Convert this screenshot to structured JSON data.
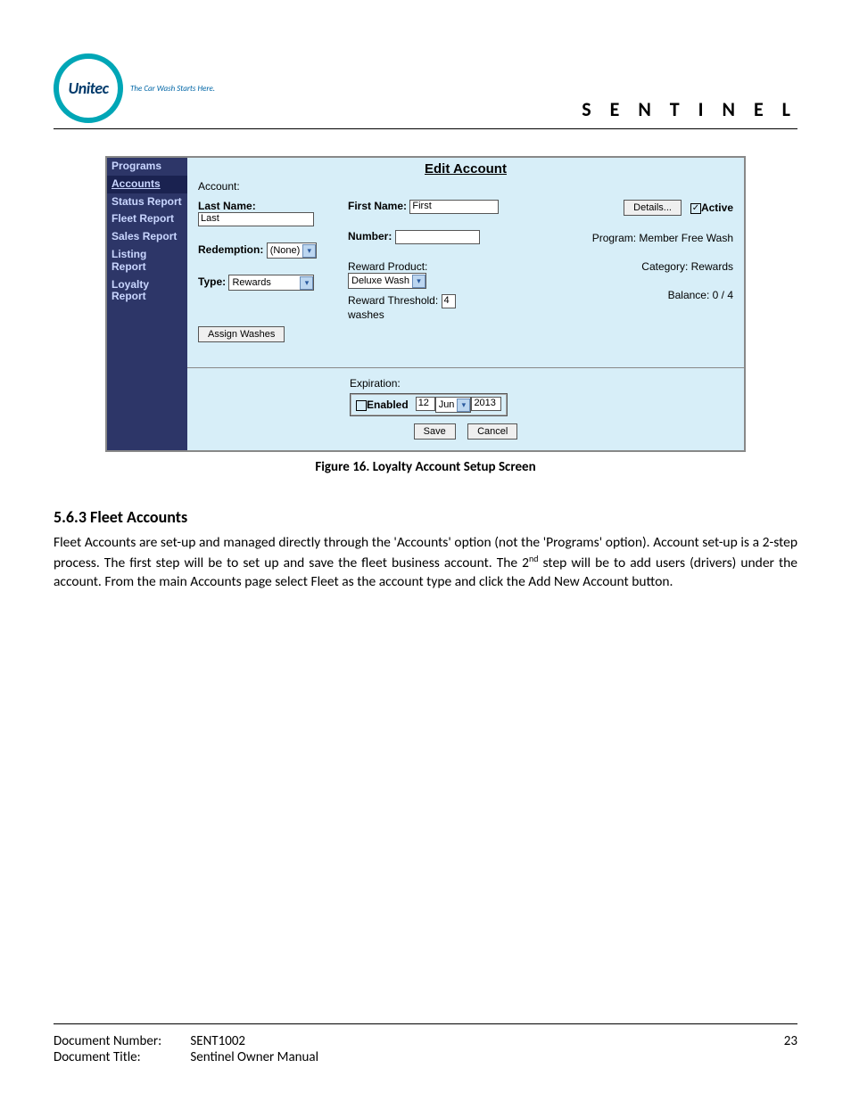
{
  "header": {
    "logo_text": "Unitec",
    "tagline": "The Car Wash Starts Here.",
    "product": "S E N T I N E L"
  },
  "screenshot": {
    "sidebar": {
      "items": [
        {
          "label": "Programs"
        },
        {
          "label": "Accounts",
          "selected": true
        },
        {
          "label": "Status Report"
        },
        {
          "label": "Fleet Report"
        },
        {
          "label": "Sales Report"
        },
        {
          "label": "Listing Report"
        },
        {
          "label": "Loyalty Report"
        }
      ]
    },
    "title": "Edit Account",
    "account_label": "Account:",
    "col1": {
      "last_name_label": "Last Name:",
      "last_name_value": "Last",
      "redemption_label": "Redemption:",
      "redemption_value": "(None)",
      "type_label": "Type:",
      "type_value": "Rewards",
      "assign_button": "Assign Washes"
    },
    "col2": {
      "first_name_label": "First Name:",
      "first_name_value": "First",
      "number_label": "Number:",
      "reward_product_label": "Reward Product:",
      "reward_product_value": "Deluxe Wash",
      "reward_threshold_label": "Reward Threshold:",
      "reward_threshold_value": "4",
      "reward_threshold_suffix": "washes",
      "expiration_label": "Expiration:",
      "enabled_label": "Enabled",
      "exp_day": "12",
      "exp_month": "Jun",
      "exp_year": "2013",
      "save_button": "Save",
      "cancel_button": "Cancel"
    },
    "col3": {
      "details_button": "Details...",
      "active_label": "Active",
      "program_label": "Program: Member Free Wash",
      "category_label": "Category: Rewards",
      "balance_label": "Balance: 0 / 4"
    }
  },
  "figure_caption": "Figure 16. Loyalty Account Setup Screen",
  "section_heading": "5.6.3  Fleet Accounts",
  "body_para_1a": "Fleet Accounts are set-up and managed directly through the 'Accounts' option (not the 'Programs' option). Account set-up is a 2-step process. The first step will be to set up and save the fleet business account. The 2",
  "body_para_1_sup": "nd",
  "body_para_1b": " step will be to add users (drivers) under the account. From the main Accounts page select Fleet as the account type and click the Add New Account button.",
  "footer": {
    "doc_number_label": "Document Number:",
    "doc_number_value": "SENT1002",
    "doc_title_label": "Document Title:",
    "doc_title_value": "Sentinel Owner Manual",
    "page_number": "23"
  }
}
